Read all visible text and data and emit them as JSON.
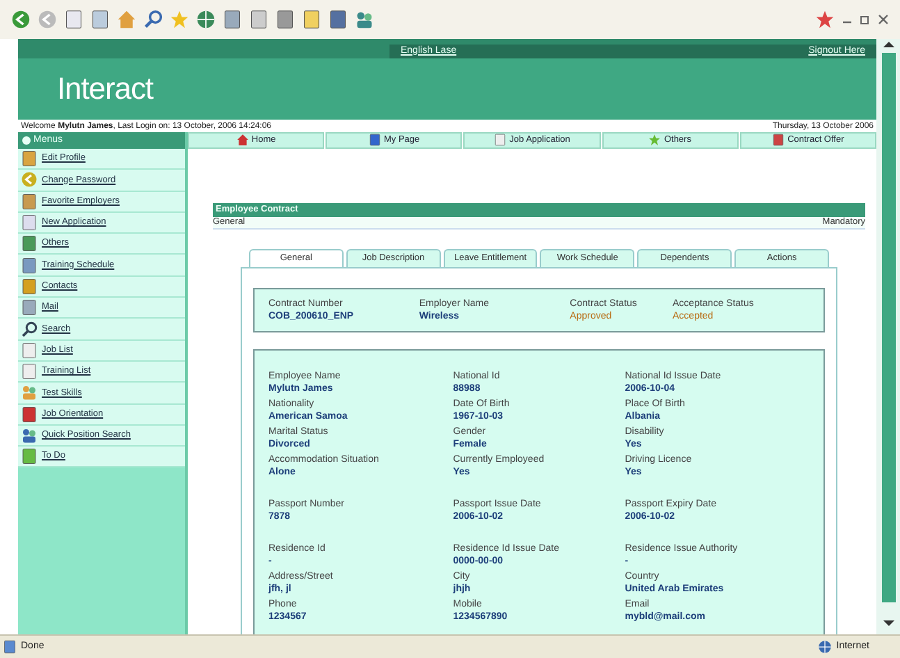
{
  "header": {
    "logo": "Interact",
    "links": [
      "English Lase",
      "Signout Here"
    ]
  },
  "welcome": {
    "text": "Welcome **Mylutn James**, Last Login on: 13 October, 2006 14:24:06",
    "date": "Thursday, 13 October 2006"
  },
  "sidebar": {
    "title": "Menus",
    "items": [
      "Edit Profile",
      "Change Password",
      "Favorite Employers",
      "New Application",
      "Others",
      "Training Schedule",
      "Contacts",
      "Mail",
      "Search",
      "Job List",
      "Training List",
      "Test Skills",
      "Job Orientation",
      "Quick Position Search",
      "To Do"
    ]
  },
  "nav": [
    "Home",
    "My Page",
    "Job Application",
    "Others",
    "Contract Offer"
  ],
  "panel": {
    "title": "Employee Contract",
    "section": "General",
    "note": "Mandatory",
    "tabs": [
      {
        "label": "General",
        "selected": true
      },
      {
        "label": "Job Description",
        "selected": false
      },
      {
        "label": "Leave Entitlement",
        "selected": false
      },
      {
        "label": "Work Schedule",
        "selected": false
      },
      {
        "label": "Dependents",
        "selected": false
      },
      {
        "label": "Actions",
        "selected": false
      }
    ],
    "summary": [
      {
        "label": "Contract Number",
        "value": "COB_200610_ENP",
        "kind": "value"
      },
      {
        "label": "Employer Name",
        "value": "Wireless",
        "kind": "value"
      },
      {
        "label": "Contract Status",
        "value": "Approved",
        "kind": "status"
      },
      {
        "label": "Acceptance Status",
        "value": "Accepted",
        "kind": "status"
      }
    ],
    "groups": [
      [
        {
          "label": "Employee Name",
          "value": "Mylutn James"
        },
        {
          "label": "National Id",
          "value": "88988"
        },
        {
          "label": "National Id Issue Date",
          "value": "2006-10-04"
        },
        {
          "label": "Nationality",
          "value": "American Samoa"
        },
        {
          "label": "Date Of Birth",
          "value": "1967-10-03"
        },
        {
          "label": "Place Of Birth",
          "value": "Albania"
        },
        {
          "label": "Marital Status",
          "value": "Divorced"
        },
        {
          "label": "Gender",
          "value": "Female"
        },
        {
          "label": "Disability",
          "value": "Yes"
        },
        {
          "label": "Accommodation Situation",
          "value": "Alone"
        },
        {
          "label": "Currently Employeed",
          "value": "Yes"
        },
        {
          "label": "Driving Licence",
          "value": "Yes"
        }
      ],
      [
        {
          "label": "Passport Number",
          "value": "7878"
        },
        {
          "label": "Passport Issue Date",
          "value": "2006-10-02"
        },
        {
          "label": "Passport Expiry Date",
          "value": "2006-10-02"
        }
      ],
      [
        {
          "label": "Residence Id",
          "value": "-"
        },
        {
          "label": "Residence Id Issue Date",
          "value": "0000-00-00"
        },
        {
          "label": "Residence Issue Authority",
          "value": "-"
        },
        {
          "label": "Address/Street",
          "value": "jfh, jl"
        },
        {
          "label": "City",
          "value": "jhjh"
        },
        {
          "label": "Country",
          "value": "United Arab Emirates"
        },
        {
          "label": "Phone",
          "value": "1234567"
        },
        {
          "label": "Mobile",
          "value": "1234567890"
        },
        {
          "label": "Email",
          "value": "mybld@mail.com"
        }
      ]
    ]
  },
  "status_bar": {
    "left": "Done",
    "right": "Internet"
  }
}
